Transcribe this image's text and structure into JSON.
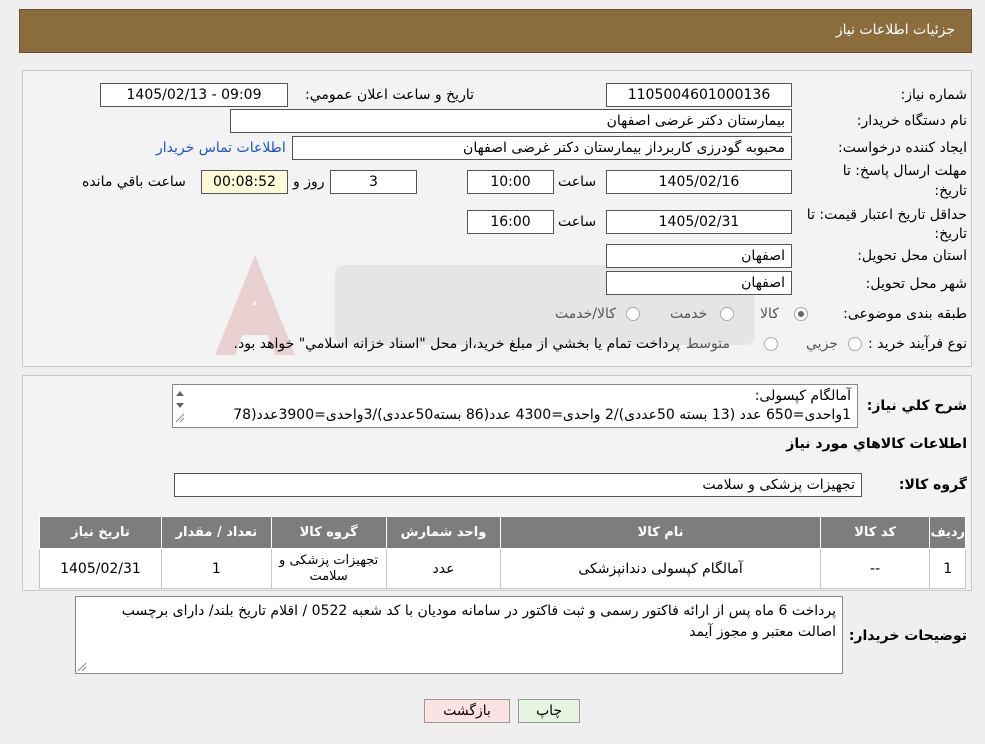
{
  "header": {
    "title": "جزئیات اطلاعات نیاز"
  },
  "labels": {
    "need_number": "شماره نیاز:",
    "announce_datetime": "تاريخ و ساعت اعلان عمومي:",
    "buyer_org": "نام دستگاه خريدار:",
    "requester": "ايجاد کننده درخواست:",
    "deadline_l1": "مهلت ارسال پاسخ: تا",
    "deadline_l2": "تاريخ:",
    "validity_l1": "حداقل تاريخ اعتبار قيمت: تا",
    "validity_l2": "تاريخ:",
    "time_word": "ساعت",
    "days_word": "روز و",
    "remaining_word": "ساعت باقي مانده",
    "province": "استان محل تحويل:",
    "city": "شهر محل تحويل:",
    "category": "طبقه بندی موضوعی:",
    "purchase_type": "نوع فرآيند خريد :",
    "need_desc": "شرح کلي نياز:",
    "goods_info": "اطلاعات کالاهاي مورد نياز",
    "goods_group": "گروه کالا:",
    "buyer_notes": "توضيحات خريدار:"
  },
  "fields": {
    "need_number": "1105004601000136",
    "announce_datetime": "1405/02/13 - 09:09",
    "buyer_org": "بیمارستان دکتر غرضی اصفهان",
    "requester": "محبوبه گودرزی کاربرداز بیمارستان دکتر غرضی اصفهان",
    "contact_link": "اطلاعات تماس خريدار",
    "deadline_date": "1405/02/16",
    "deadline_time": "10:00",
    "deadline_days": "3",
    "remaining_time": "00:08:52",
    "validity_date": "1405/02/31",
    "validity_time": "16:00",
    "province": "اصفهان",
    "city": "اصفهان",
    "goods_group": "تجهیزات پزشکی و سلامت"
  },
  "category_options": [
    "کالا",
    "خدمت",
    "کالا/خدمت"
  ],
  "category_selected": "کالا",
  "purchase_options": [
    "جزیي",
    "متوسط"
  ],
  "purchase_note": "پرداخت تمام يا بخشي از مبلغ خريد،از محل \"اسناد خزانه اسلامي\" خواهد بود.",
  "need_desc": {
    "line1": "آمالگام کپسولی:",
    "line2": "1واحدی=650 عدد (13 بسته 50عددی)/2 واحدی=4300 عدد(86 بسته50عددی)/3واحدی=3900عدد(78"
  },
  "table": {
    "headers": [
      "رديف",
      "کد کالا",
      "نام کالا",
      "واحد شمارش",
      "گروه کالا",
      "تعداد / مقدار",
      "تاريخ نياز"
    ],
    "rows": [
      [
        "1",
        "--",
        "آمالگام کپسولی دندانپزشکی",
        "عدد",
        "تجهیزات پزشکی و سلامت",
        "1",
        "1405/02/31"
      ]
    ]
  },
  "buyer_notes": "پرداخت 6 ماه پس از ارائه فاکتور رسمی و ثبت فاکتور در سامانه مودیان با کد شعبه 0522 / اقلام تاریخ بلند/ دارای برچسب اصالت معتبر و مجوز آیمد",
  "buttons": {
    "print": "چاپ",
    "back": "بازگشت"
  },
  "colors": {
    "header_bg": "#8b6d3d",
    "table_header_bg": "#7d7d7d",
    "back_button_bg": "#fbe3e3",
    "print_button_bg": "#e6f5e2",
    "countdown_bg": "#fffbd9"
  }
}
